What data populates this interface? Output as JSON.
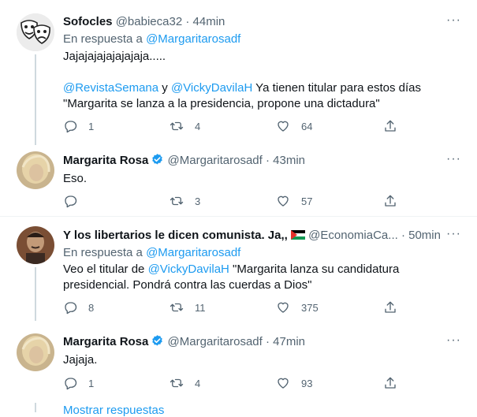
{
  "tweets": [
    {
      "name": "Sofocles",
      "handle": "@babieca32",
      "dot": "·",
      "time": "44min",
      "reply_prefix": "En respuesta a ",
      "reply_to": "@Margaritarosadf",
      "line1": "Jajajajajajajajaja.....",
      "mention1": "@RevistaSemana",
      "conj": " y ",
      "mention2": "@VickyDavilaH",
      "line2_rest": " Ya tienen titular para estos días",
      "line3": "\"Margarita se lanza a la presidencia, propone una dictadura\"",
      "replies": "1",
      "retweets": "4",
      "likes": "64"
    },
    {
      "name": "Margarita Rosa",
      "handle": "@Margaritarosadf",
      "dot": "·",
      "time": "43min",
      "text": "Eso.",
      "replies": "",
      "retweets": "3",
      "likes": "57"
    },
    {
      "name": "Y los libertarios le dicen comunista. Ja,,",
      "handle": "@EconomiaCa...",
      "dot": "·",
      "time": "50min",
      "reply_prefix": "En respuesta a ",
      "reply_to": "@Margaritarosadf",
      "text_prefix": "Veo el titular de ",
      "mention": "@VickyDavilaH",
      "text_rest": " \"Margarita lanza su candidatura",
      "line2": "presidencial. Pondrá contra las cuerdas a Dios\"",
      "replies": "8",
      "retweets": "11",
      "likes": "375"
    },
    {
      "name": "Margarita Rosa",
      "handle": "@Margaritarosadf",
      "dot": "·",
      "time": "47min",
      "text": "Jajaja.",
      "replies": "1",
      "retweets": "4",
      "likes": "93"
    }
  ],
  "more_label": "···",
  "show_more": "Mostrar respuestas",
  "colors": {
    "link": "#1d9bf0",
    "muted": "#536471",
    "verified": "#1d9bf0"
  }
}
